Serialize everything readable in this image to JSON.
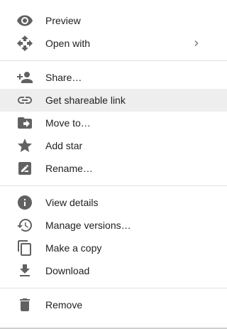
{
  "menu": {
    "groups": [
      {
        "items": [
          {
            "label": "Preview",
            "icon": "eye-icon"
          },
          {
            "label": "Open with",
            "icon": "open-with-icon",
            "submenu": true
          }
        ]
      },
      {
        "items": [
          {
            "label": "Share…",
            "icon": "person-add-icon"
          },
          {
            "label": "Get shareable link",
            "icon": "link-icon",
            "highlighted": true
          },
          {
            "label": "Move to…",
            "icon": "move-to-folder-icon"
          },
          {
            "label": "Add star",
            "icon": "star-icon"
          },
          {
            "label": "Rename…",
            "icon": "rename-icon"
          }
        ]
      },
      {
        "items": [
          {
            "label": "View details",
            "icon": "info-icon"
          },
          {
            "label": "Manage versions…",
            "icon": "history-icon"
          },
          {
            "label": "Make a copy",
            "icon": "copy-icon"
          },
          {
            "label": "Download",
            "icon": "download-icon"
          }
        ]
      },
      {
        "items": [
          {
            "label": "Remove",
            "icon": "trash-icon"
          }
        ]
      }
    ]
  },
  "colors": {
    "icon": "#616161",
    "text": "#212121",
    "highlight": "#eeeeee",
    "divider": "#e0e0e0"
  }
}
